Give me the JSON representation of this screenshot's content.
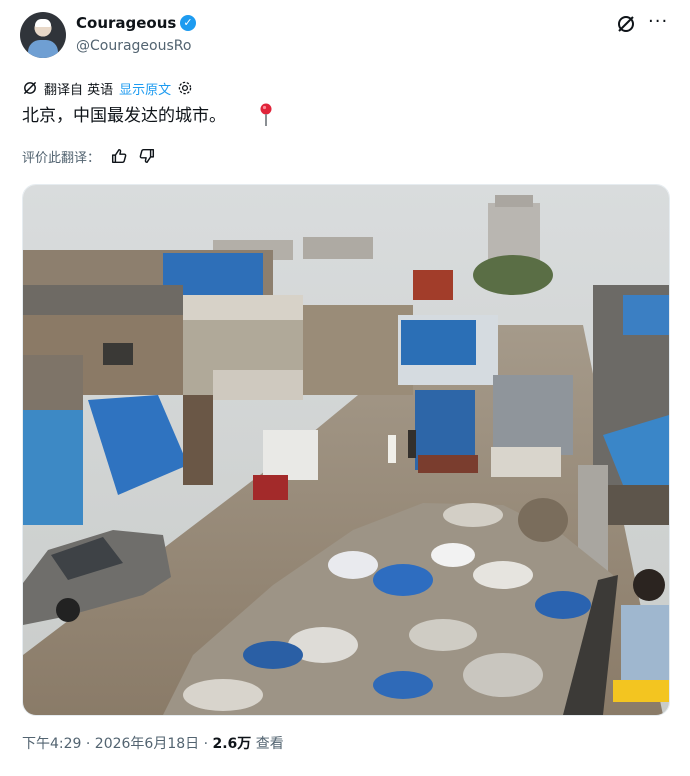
{
  "author": {
    "name": "Courageous",
    "handle": "@CourageousRo",
    "verified": true
  },
  "header_icons": [
    "grok-icon",
    "more-icon"
  ],
  "translation": {
    "prefix": "翻译自 英语",
    "show_original": "显示原文"
  },
  "tweet": {
    "text": "北京，中国最发达的城市。"
  },
  "rate_translation": {
    "label": "评价此翻译："
  },
  "footer": {
    "time": "下午4:29 · 2026年6月18日 · ",
    "views": "2.6万",
    "views_label": " 查看"
  },
  "colors": {
    "accent": "#1d9bf0",
    "secondary_text": "#536471"
  }
}
